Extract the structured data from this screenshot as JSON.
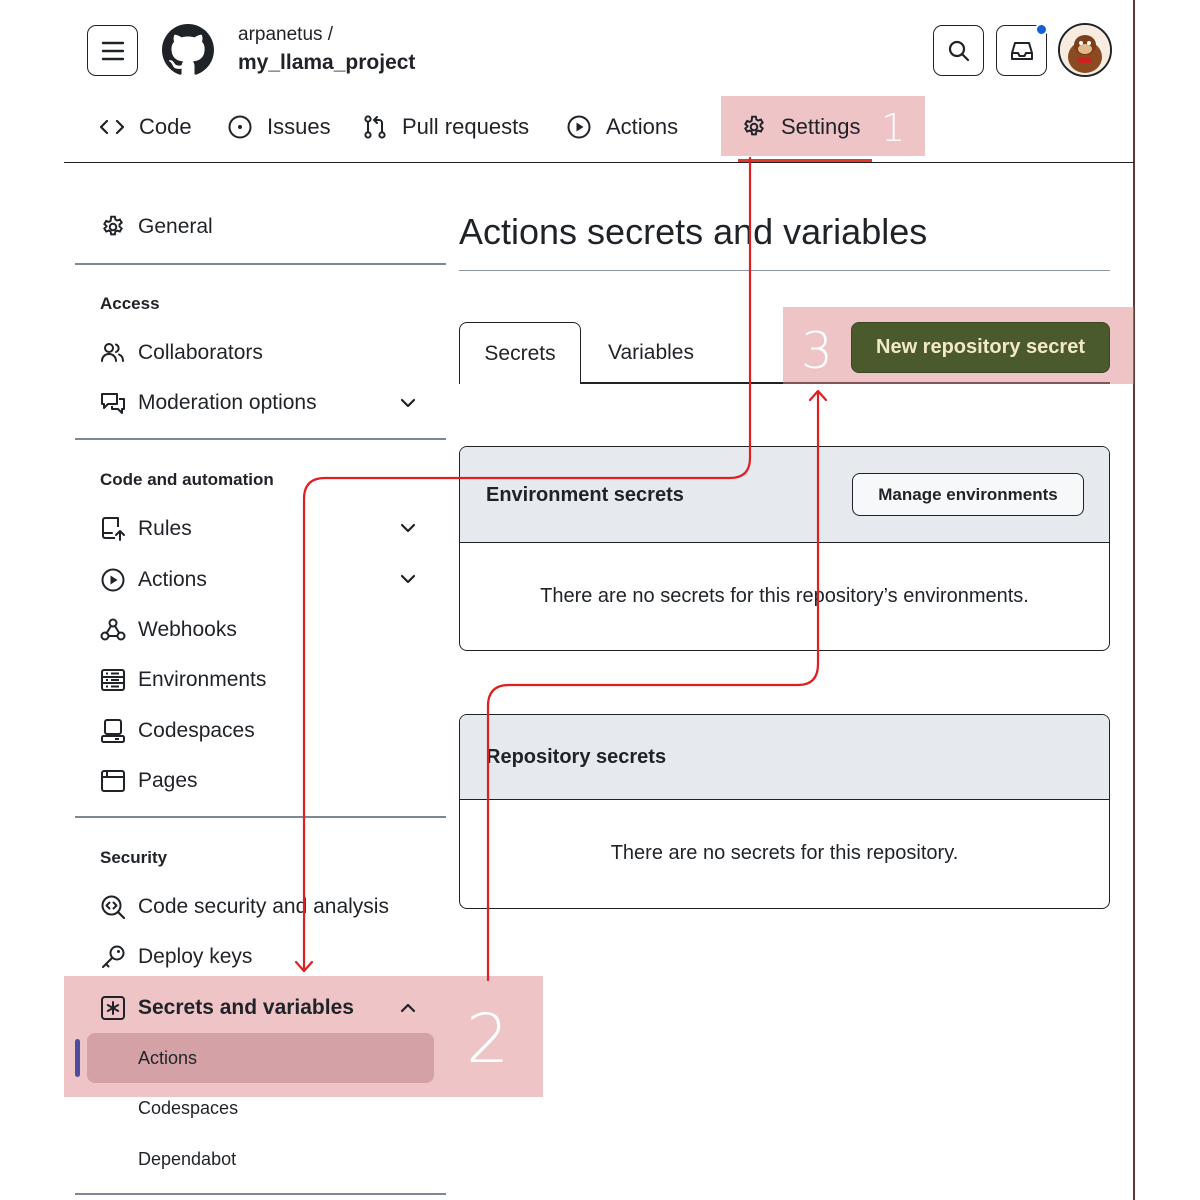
{
  "header": {
    "owner": "arpanetus /",
    "repo": "my_llama_project"
  },
  "nav": {
    "code": "Code",
    "issues": "Issues",
    "pull_requests": "Pull requests",
    "actions": "Actions",
    "settings": "Settings"
  },
  "annotations": {
    "step1": "1",
    "step2": "2",
    "step3": "3",
    "highlight_color": "#de8a90",
    "arrow_color": "#e02020"
  },
  "sidebar": {
    "general": "General",
    "access_heading": "Access",
    "collaborators": "Collaborators",
    "moderation": "Moderation options",
    "code_heading": "Code and automation",
    "rules": "Rules",
    "actions": "Actions",
    "webhooks": "Webhooks",
    "environments": "Environments",
    "codespaces": "Codespaces",
    "pages": "Pages",
    "security_heading": "Security",
    "code_security": "Code security and analysis",
    "deploy_keys": "Deploy keys",
    "secrets": "Secrets and variables",
    "sub_actions": "Actions",
    "sub_codespaces": "Codespaces",
    "sub_dependabot": "Dependabot"
  },
  "main": {
    "title": "Actions secrets and variables",
    "tab_secrets": "Secrets",
    "tab_variables": "Variables",
    "new_secret_button": "New repository secret",
    "env_secrets_title": "Environment secrets",
    "manage_env_button": "Manage environments",
    "env_empty": "There are no secrets for this repository’s environments.",
    "repo_secrets_title": "Repository secrets",
    "repo_empty": "There are no secrets for this repository."
  },
  "colors": {
    "primary_button": "#4a5a2d",
    "notification_dot": "#1160d8",
    "active_indicator": "#4c4da0"
  }
}
